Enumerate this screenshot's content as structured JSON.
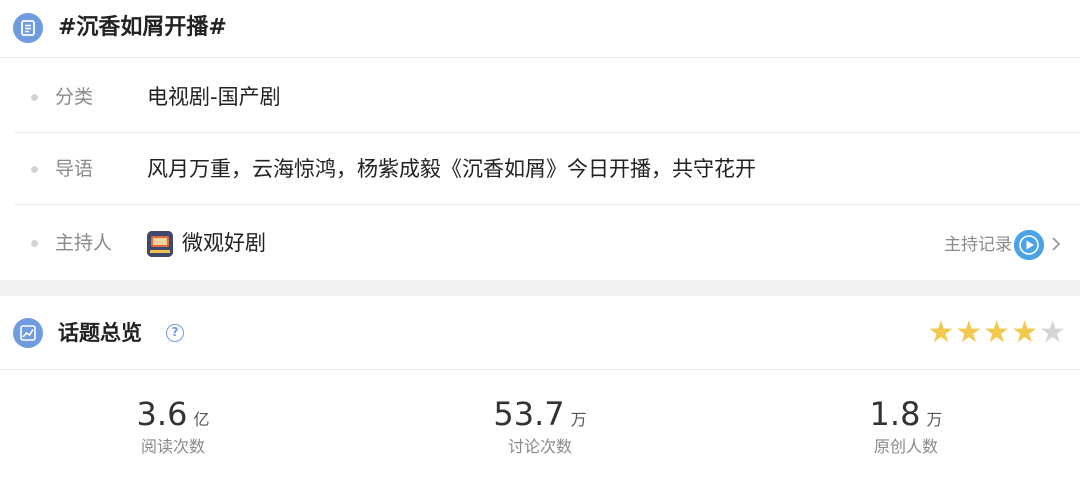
{
  "topic": {
    "title": "#沉香如屑开播#",
    "rows": [
      {
        "label": "分类",
        "value": "电视剧-国产剧"
      },
      {
        "label": "导语",
        "value": "风月万重，云海惊鸿，杨紫成毅《沉香如屑》今日开播，共守花开"
      }
    ],
    "host": {
      "label": "主持人",
      "name": "微观好剧",
      "record_label": "主持记录"
    }
  },
  "overview": {
    "title": "话题总览",
    "help_symbol": "?",
    "rating": {
      "filled": 4,
      "total": 5,
      "filled_color": "#f2c94c",
      "empty_color": "#d6d6d6"
    },
    "stats": [
      {
        "value": "3.6",
        "unit": "亿",
        "caption": "阅读次数"
      },
      {
        "value": "53.7",
        "unit": "万",
        "caption": "讨论次数"
      },
      {
        "value": "1.8",
        "unit": "万",
        "caption": "原创人数"
      }
    ]
  },
  "colors": {
    "accent": "#6f9be0",
    "muted": "#8a8a8a",
    "divider": "#ececec"
  }
}
